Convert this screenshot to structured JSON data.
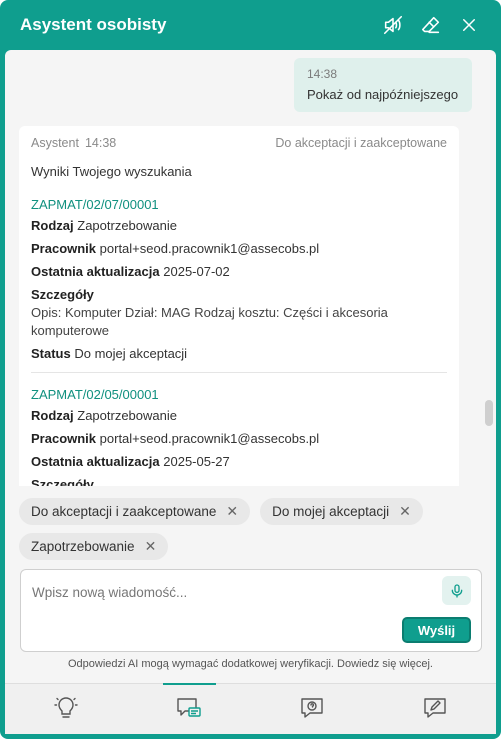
{
  "header": {
    "title": "Asystent osobisty",
    "icons": [
      "mute-icon",
      "eraser-icon",
      "close-icon"
    ]
  },
  "conversation": {
    "user_message": {
      "time": "14:38",
      "text": "Pokaż od najpóźniejszego"
    },
    "assistant_message": {
      "author": "Asystent",
      "time": "14:38",
      "filter_tag": "Do akceptacji i zaakceptowane",
      "intro": "Wyniki Twojego wyszukania",
      "results": [
        {
          "id": "ZAPMAT/02/07/00001",
          "type_label": "Rodzaj",
          "type_value": "Zapotrzebowanie",
          "employee_label": "Pracownik",
          "employee_value": "portal+seod.pracownik1@assecobs.pl",
          "updated_label": "Ostatnia aktualizacja",
          "updated_value": "2025-07-02",
          "details_label": "Szczegóły",
          "details_value": "Opis: Komputer Dział: MAG Rodzaj kosztu: Części i akcesoria komputerowe",
          "status_label": "Status",
          "status_value": "Do mojej akceptacji"
        },
        {
          "id": "ZAPMAT/02/05/00001",
          "type_label": "Rodzaj",
          "type_value": "Zapotrzebowanie",
          "employee_label": "Pracownik",
          "employee_value": "portal+seod.pracownik1@assecobs.pl",
          "updated_label": "Ostatnia aktualizacja",
          "updated_value": "2025-05-27",
          "details_label": "Szczegóły"
        }
      ]
    }
  },
  "filter_chips": [
    {
      "label": "Do akceptacji i zaakceptowane"
    },
    {
      "label": "Do mojej akceptacji"
    },
    {
      "label": "Zapotrzebowanie"
    }
  ],
  "composer": {
    "placeholder": "Wpisz nową wiadomość...",
    "send_label": "Wyślij",
    "mic_icon": "microphone-icon"
  },
  "disclaimer": "Odpowiedzi AI mogą wymagać dodatkowej weryfikacji. Dowiedz się więcej.",
  "bottom_nav": [
    {
      "icon": "lightbulb-icon",
      "active": false
    },
    {
      "icon": "chat-icon",
      "active": true
    },
    {
      "icon": "help-chat-icon",
      "active": false
    },
    {
      "icon": "edit-chat-icon",
      "active": false
    }
  ],
  "colors": {
    "accent": "#0f9e8e",
    "link": "#10907f",
    "user_bubble": "#dff0ec"
  }
}
